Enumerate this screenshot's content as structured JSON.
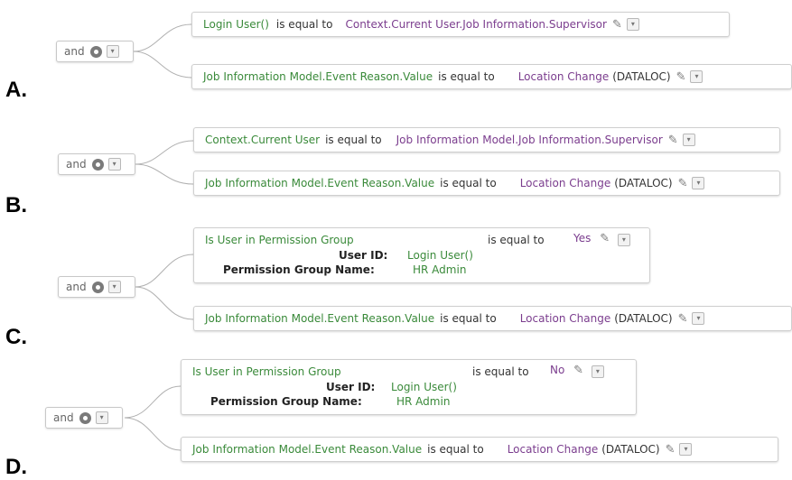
{
  "options": [
    {
      "letter": "A.",
      "group": {
        "label": "and"
      },
      "conditions": [
        {
          "left": "Login User()",
          "operator": "is equal to",
          "right": "Context.Current User.Job Information.Supervisor"
        },
        {
          "left": "Job Information Model.Event Reason.Value",
          "operator": "is equal to",
          "right": "Location Change",
          "right_code": "(DATALOC)"
        }
      ]
    },
    {
      "letter": "B.",
      "group": {
        "label": "and"
      },
      "conditions": [
        {
          "left": "Context.Current User",
          "operator": "is equal to",
          "right": "Job Information Model.Job Information.Supervisor"
        },
        {
          "left": "Job Information Model.Event Reason.Value",
          "operator": "is equal to",
          "right": "Location Change",
          "right_code": "(DATALOC)"
        }
      ]
    },
    {
      "letter": "C.",
      "group": {
        "label": "and"
      },
      "conditions": [
        {
          "left": "Is User in Permission Group",
          "operator": "is equal to",
          "right": "Yes",
          "params": [
            {
              "name": "User ID:",
              "value": "Login User()"
            },
            {
              "name": "Permission Group Name:",
              "value": "HR Admin"
            }
          ]
        },
        {
          "left": "Job Information Model.Event Reason.Value",
          "operator": "is equal to",
          "right": "Location Change",
          "right_code": "(DATALOC)"
        }
      ]
    },
    {
      "letter": "D.",
      "group": {
        "label": "and"
      },
      "conditions": [
        {
          "left": "Is User in Permission Group",
          "operator": "is equal to",
          "right": "No",
          "params": [
            {
              "name": "User ID:",
              "value": "Login User()"
            },
            {
              "name": "Permission Group Name:",
              "value": "HR Admin"
            }
          ]
        },
        {
          "left": "Job Information Model.Event Reason.Value",
          "operator": "is equal to",
          "right": "Location Change",
          "right_code": "(DATALOC)"
        }
      ]
    }
  ]
}
